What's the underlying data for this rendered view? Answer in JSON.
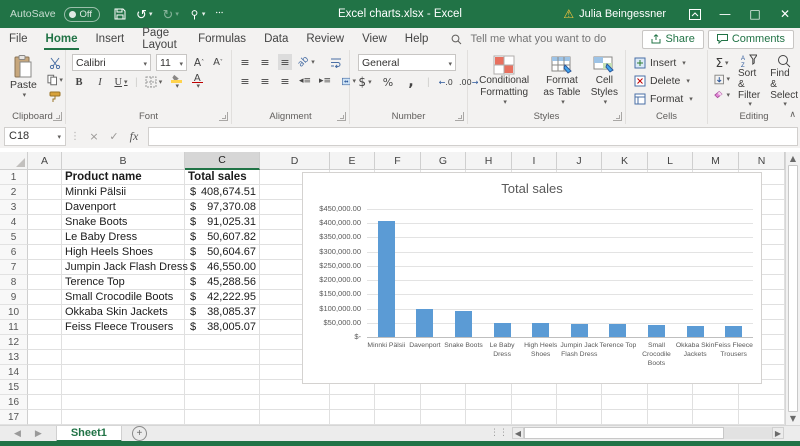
{
  "titlebar": {
    "autosave_label": "AutoSave",
    "autosave_state": "Off",
    "title": "Excel charts.xlsx - Excel",
    "user_name": "Julia Beingessner"
  },
  "menu": {
    "tabs": [
      {
        "label": "File",
        "active": false
      },
      {
        "label": "Home",
        "active": true
      },
      {
        "label": "Insert",
        "active": false
      },
      {
        "label": "Page Layout",
        "active": false
      },
      {
        "label": "Formulas",
        "active": false
      },
      {
        "label": "Data",
        "active": false
      },
      {
        "label": "Review",
        "active": false
      },
      {
        "label": "View",
        "active": false
      },
      {
        "label": "Help",
        "active": false
      }
    ],
    "search_placeholder": "Tell me what you want to do",
    "share_label": "Share",
    "comments_label": "Comments"
  },
  "ribbon": {
    "clipboard": {
      "paste": "Paste",
      "label": "Clipboard"
    },
    "font": {
      "family": "Calibri",
      "size": "11",
      "bold": "B",
      "italic": "I",
      "underline": "U",
      "grow": "A",
      "shrink": "A",
      "color_letter": "A",
      "label": "Font"
    },
    "alignment": {
      "label": "Alignment"
    },
    "number": {
      "format": "General",
      "currency": "$",
      "percent": "%",
      "comma": ",",
      "inc_dec": ".00",
      "dec_dec": ".0",
      "label": "Number"
    },
    "styles": {
      "conditional": "Conditional Formatting",
      "format_table": "Format as Table",
      "cell_styles": "Cell Styles",
      "label": "Styles"
    },
    "cells": {
      "insert": "Insert",
      "delete": "Delete",
      "format": "Format",
      "label": "Cells"
    },
    "editing": {
      "autosum": "Σ",
      "sort_filter": "Sort & Filter",
      "find_select": "Find & Select",
      "label": "Editing"
    }
  },
  "formula_bar": {
    "name_box": "C18",
    "cancel": "×",
    "enter": "✓",
    "fx": "fx",
    "formula": ""
  },
  "sheet": {
    "columns": [
      "A",
      "B",
      "C",
      "D",
      "E",
      "F",
      "G",
      "H",
      "I",
      "J",
      "K",
      "L",
      "M",
      "N"
    ],
    "selected_column": "C",
    "row_count": 17,
    "header_product": "Product name",
    "header_sales": "Total sales",
    "data": [
      {
        "name": "Minnki Pälsii",
        "currency": "$",
        "amount": "408,674.51"
      },
      {
        "name": "Davenport",
        "currency": "$",
        "amount": "97,370.08"
      },
      {
        "name": "Snake Boots",
        "currency": "$",
        "amount": "91,025.31"
      },
      {
        "name": "Le Baby Dress",
        "currency": "$",
        "amount": "50,607.82"
      },
      {
        "name": "High Heels Shoes",
        "currency": "$",
        "amount": "50,604.67"
      },
      {
        "name": "Jumpin Jack Flash Dress",
        "currency": "$",
        "amount": "46,550.00"
      },
      {
        "name": "Terence Top",
        "currency": "$",
        "amount": "45,288.56"
      },
      {
        "name": "Small Crocodile Boots",
        "currency": "$",
        "amount": "42,222.95"
      },
      {
        "name": "Okkaba Skin Jackets",
        "currency": "$",
        "amount": "38,085.37"
      },
      {
        "name": "Feiss Fleece Trousers",
        "currency": "$",
        "amount": "38,005.07"
      }
    ]
  },
  "chart_data": {
    "type": "bar",
    "title": "Total sales",
    "categories": [
      "Minnki Pälsii",
      "Davenport",
      "Snake Boots",
      "Le Baby Dress",
      "High Heels Shoes",
      "Jumpin Jack Flash Dress",
      "Terence Top",
      "Small Crocodile Boots",
      "Okkaba Skin Jackets",
      "Feiss Fleece Trousers"
    ],
    "values": [
      408674.51,
      97370.08,
      91025.31,
      50607.82,
      50604.67,
      46550.0,
      45288.56,
      42222.95,
      38085.37,
      38005.07
    ],
    "ylim": [
      0,
      450000
    ],
    "ytick_labels": [
      "$450,000.00",
      "$400,000.00",
      "$350,000.00",
      "$300,000.00",
      "$250,000.00",
      "$200,000.00",
      "$150,000.00",
      "$100,000.00",
      "$50,000.00",
      "$-"
    ],
    "bar_color": "#5B9BD5",
    "grid": true,
    "legend": "none",
    "xlabel": "",
    "ylabel": ""
  },
  "sheet_tabs": {
    "active": "Sheet1",
    "add_label": "+"
  },
  "colors": {
    "brand_green": "#217346",
    "bar_blue": "#5B9BD5",
    "warning_yellow": "#ffc83d"
  }
}
